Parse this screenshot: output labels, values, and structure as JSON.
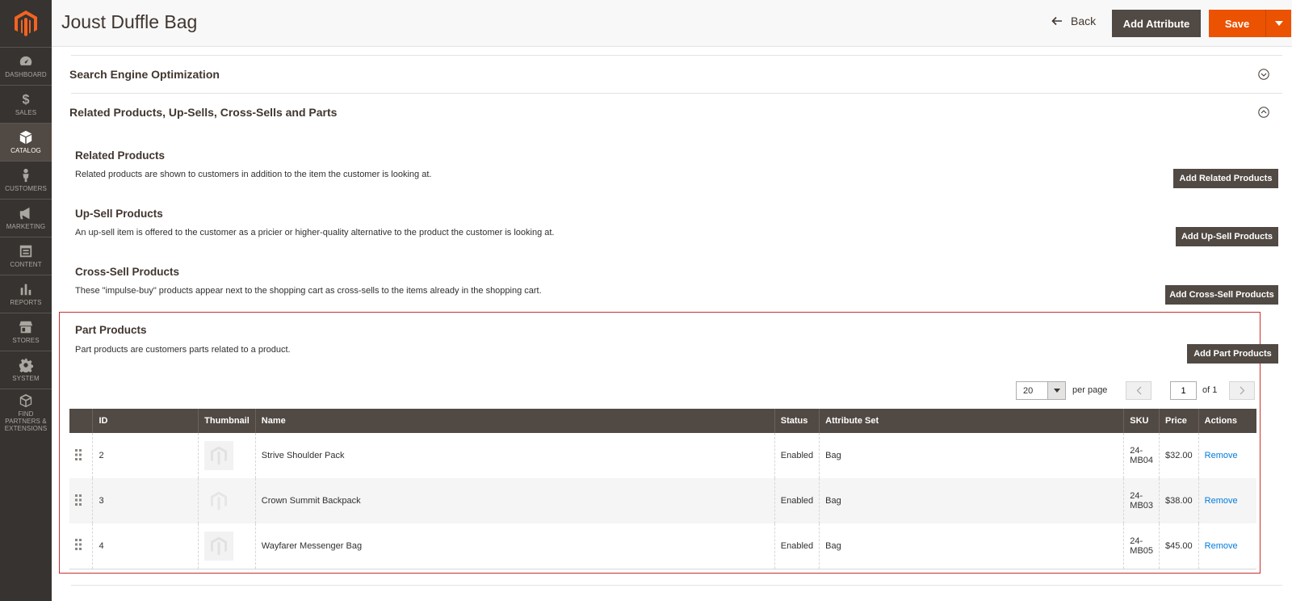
{
  "sidebar": {
    "items": [
      {
        "label": "Dashboard",
        "icon": "dashboard-icon"
      },
      {
        "label": "Sales",
        "icon": "dollar-icon"
      },
      {
        "label": "Catalog",
        "icon": "box-icon"
      },
      {
        "label": "Customers",
        "icon": "person-icon"
      },
      {
        "label": "Marketing",
        "icon": "megaphone-icon"
      },
      {
        "label": "Content",
        "icon": "layout-icon"
      },
      {
        "label": "Reports",
        "icon": "bar-chart-icon"
      },
      {
        "label": "Stores",
        "icon": "store-icon"
      },
      {
        "label": "System",
        "icon": "gear-icon"
      },
      {
        "label": "Find Partners & Extensions",
        "icon": "cubes-icon"
      }
    ]
  },
  "header": {
    "title": "Joust Duffle Bag",
    "back_label": "Back",
    "add_attribute_label": "Add Attribute",
    "save_label": "Save"
  },
  "sections": {
    "seo_title": "Search Engine Optimization",
    "related_title": "Related Products, Up-Sells, Cross-Sells and Parts"
  },
  "related": {
    "title": "Related Products",
    "desc": "Related products are shown to customers in addition to the item the customer is looking at.",
    "button": "Add Related Products"
  },
  "upsell": {
    "title": "Up-Sell Products",
    "desc": "An up-sell item is offered to the customer as a pricier or higher-quality alternative to the product the customer is looking at.",
    "button": "Add Up-Sell Products"
  },
  "crosssell": {
    "title": "Cross-Sell Products",
    "desc": "These \"impulse-buy\" products appear next to the shopping cart as cross-sells to the items already in the shopping cart.",
    "button": "Add Cross-Sell Products"
  },
  "parts": {
    "title": "Part Products",
    "desc": "Part products are customers parts related to a product.",
    "button": "Add Part Products"
  },
  "pager": {
    "per_page_value": "20",
    "per_page_label": "per page",
    "page": "1",
    "of_label": "of 1"
  },
  "table": {
    "columns": [
      "ID",
      "Thumbnail",
      "Name",
      "Status",
      "Attribute Set",
      "SKU",
      "Price",
      "Actions"
    ],
    "rows": [
      {
        "id": "2",
        "name": "Strive Shoulder Pack",
        "status": "Enabled",
        "attr_set": "Bag",
        "sku": "24-MB04",
        "price": "$32.00",
        "action": "Remove"
      },
      {
        "id": "3",
        "name": "Crown Summit Backpack",
        "status": "Enabled",
        "attr_set": "Bag",
        "sku": "24-MB03",
        "price": "$38.00",
        "action": "Remove"
      },
      {
        "id": "4",
        "name": "Wayfarer Messenger Bag",
        "status": "Enabled",
        "attr_set": "Bag",
        "sku": "24-MB05",
        "price": "$45.00",
        "action": "Remove"
      }
    ]
  },
  "colors": {
    "sidebar_bg": "#373330",
    "accent": "#eb5202",
    "dark_button": "#514943",
    "link": "#007bdb",
    "highlight": "#c8302f"
  }
}
